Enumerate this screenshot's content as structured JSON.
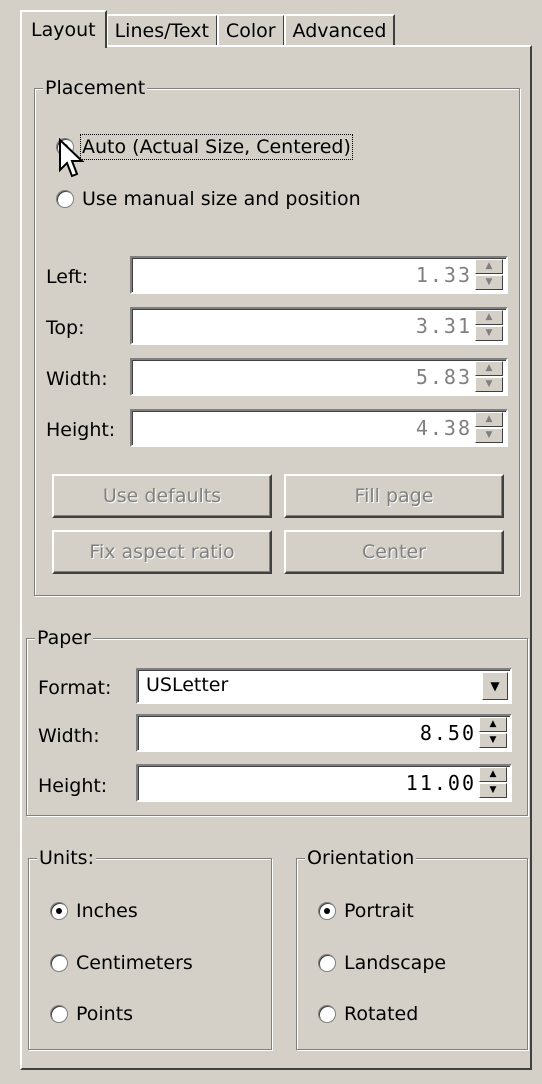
{
  "tabs": [
    "Layout",
    "Lines/Text",
    "Color",
    "Advanced"
  ],
  "placement": {
    "title": "Placement",
    "radio_auto": "Auto (Actual Size, Centered)",
    "radio_manual": "Use manual size and position",
    "selected": "auto",
    "left_label": "Left:",
    "left_value": "1.33",
    "top_label": "Top:",
    "top_value": "3.31",
    "width_label": "Width:",
    "width_value": "5.83",
    "height_label": "Height:",
    "height_value": "4.38",
    "btn_defaults": "Use defaults",
    "btn_fill": "Fill page",
    "btn_fix": "Fix aspect ratio",
    "btn_center": "Center"
  },
  "paper": {
    "title": "Paper",
    "format_label": "Format:",
    "format_value": "USLetter",
    "width_label": "Width:",
    "width_value": "8.50",
    "height_label": "Height:",
    "height_value": "11.00"
  },
  "units": {
    "title": "Units:",
    "options": [
      "Inches",
      "Centimeters",
      "Points"
    ],
    "selected": "Inches"
  },
  "orientation": {
    "title": "Orientation",
    "options": [
      "Portrait",
      "Landscape",
      "Rotated"
    ],
    "selected": "Portrait"
  },
  "icons": {
    "spin_up": "spin-up-arrow-icon",
    "spin_down": "spin-down-arrow-icon",
    "dropdown": "chevron-down-icon",
    "cursor": "mouse-pointer-icon"
  }
}
